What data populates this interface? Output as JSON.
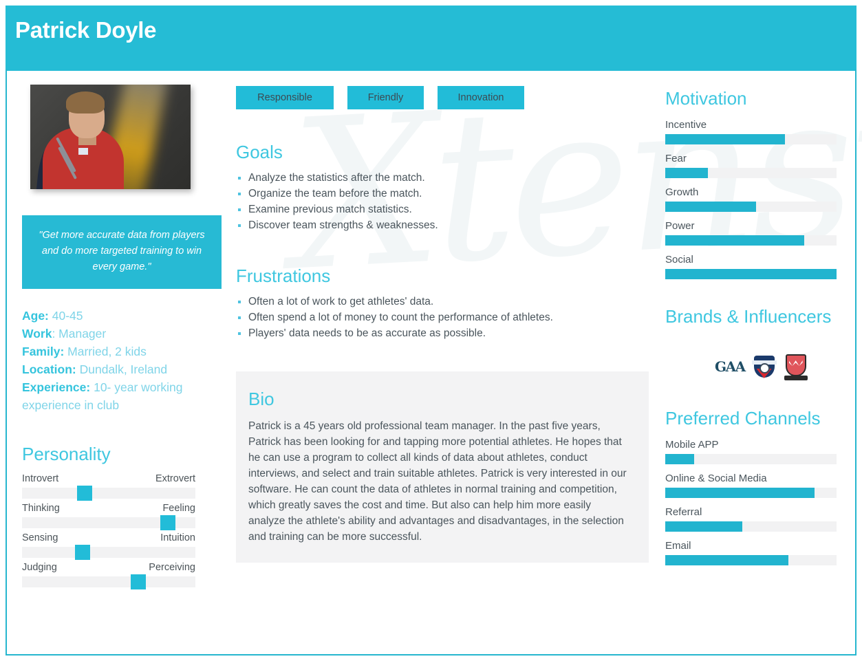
{
  "header": {
    "title": "Patrick Doyle"
  },
  "watermark": {
    "text": "Xtensio"
  },
  "photo": {
    "alt": "persona-photo"
  },
  "quote": {
    "text": "\"Get more accurate data from players and do more targeted training to win every game.\""
  },
  "facts": [
    {
      "key": "Age:",
      "value": " 40-45"
    },
    {
      "key": "Work",
      "value": ": Manager"
    },
    {
      "key": "Family:",
      "value": " Married, 2 kids"
    },
    {
      "key": "Location:",
      "value": " Dundalk, Ireland"
    },
    {
      "key": "Experience:",
      "value": " 10- year working experience in club"
    }
  ],
  "personality": {
    "title": "Personality",
    "sliders": [
      {
        "left": "Introvert",
        "right": "Extrovert",
        "value": 36
      },
      {
        "left": "Thinking",
        "right": "Feeling",
        "value": 84
      },
      {
        "left": "Sensing",
        "right": "Intuition",
        "value": 35
      },
      {
        "left": "Judging",
        "right": "Perceiving",
        "value": 67
      }
    ]
  },
  "tags": [
    "Responsible",
    "Friendly",
    "Innovation"
  ],
  "goals": {
    "title": "Goals",
    "items": [
      "Analyze the statistics after the match.",
      "Organize the team before the match.",
      "Examine previous match statistics.",
      "Discover team strengths & weaknesses."
    ]
  },
  "frustrations": {
    "title": "Frustrations",
    "items": [
      "Often a lot of work to get athletes' data.",
      "Often spend a lot of money to count the performance of athletes.",
      "Players' data needs to be as accurate as possible."
    ]
  },
  "bio": {
    "title": "Bio",
    "text": "Patrick is a 45 years old professional team manager. In the past five years, Patrick has been looking for and tapping more potential athletes. He hopes that he can use a program to collect all kinds of data about athletes, conduct interviews, and select and train suitable athletes. Patrick is very interested in our software. He can count the data of athletes in normal training and competition, which greatly saves the cost and time. But also can help him more easily analyze the athlete's ability and advantages and disadvantages, in the selection and training can be more successful."
  },
  "motivation": {
    "title": "Motivation",
    "items": [
      {
        "label": "Incentive",
        "value": 70
      },
      {
        "label": "Fear",
        "value": 25
      },
      {
        "label": "Growth",
        "value": 53
      },
      {
        "label": "Power",
        "value": 81
      },
      {
        "label": "Social",
        "value": 100
      }
    ]
  },
  "brands": {
    "title": "Brands & Influencers",
    "logos": [
      "gaa-logo",
      "club-crest-logo",
      "dundalk-crest-logo"
    ],
    "gaa_text": "GAA"
  },
  "channels": {
    "title": "Preferred Channels",
    "items": [
      {
        "label": "Mobile APP",
        "value": 17
      },
      {
        "label": "Online & Social Media",
        "value": 87
      },
      {
        "label": "Referral",
        "value": 45
      },
      {
        "label": "Email",
        "value": 72
      }
    ]
  },
  "colors": {
    "accent": "#22bcd8",
    "header": "#25bcd5",
    "heading": "#3fc7e0",
    "bar": "#22b4cf",
    "track": "#f2f2f3",
    "text": "#4a555c"
  },
  "chart_data": [
    {
      "type": "bar",
      "title": "Motivation",
      "categories": [
        "Incentive",
        "Fear",
        "Growth",
        "Power",
        "Social"
      ],
      "values": [
        70,
        25,
        53,
        81,
        100
      ],
      "xlabel": "",
      "ylabel": "",
      "ylim": [
        0,
        100
      ],
      "orientation": "horizontal",
      "grid": false,
      "legend": "none"
    },
    {
      "type": "bar",
      "title": "Preferred Channels",
      "categories": [
        "Mobile APP",
        "Online & Social Media",
        "Referral",
        "Email"
      ],
      "values": [
        17,
        87,
        45,
        72
      ],
      "xlabel": "",
      "ylabel": "",
      "ylim": [
        0,
        100
      ],
      "orientation": "horizontal",
      "grid": false,
      "legend": "none"
    },
    {
      "type": "bar",
      "title": "Personality",
      "categories": [
        "Introvert-Extrovert",
        "Thinking-Feeling",
        "Sensing-Intuition",
        "Judging-Perceiving"
      ],
      "values": [
        36,
        84,
        35,
        67
      ],
      "xlabel": "",
      "ylabel": "",
      "ylim": [
        0,
        100
      ],
      "orientation": "horizontal",
      "grid": false,
      "legend": "none"
    }
  ]
}
